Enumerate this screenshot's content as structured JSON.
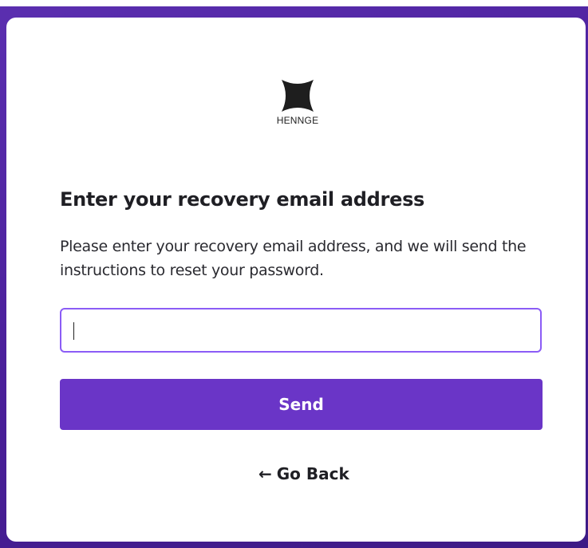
{
  "brand": {
    "name": "HENNGE"
  },
  "form": {
    "title": "Enter your recovery email address",
    "description": "Please enter your recovery email address, and we will send the instructions to reset your password.",
    "email_value": "",
    "send_label": "Send",
    "back_label": "Go Back",
    "back_arrow": "←"
  },
  "colors": {
    "accent": "#6a35c7",
    "input_border": "#8b5cf6",
    "background": "#4a1f9a"
  }
}
